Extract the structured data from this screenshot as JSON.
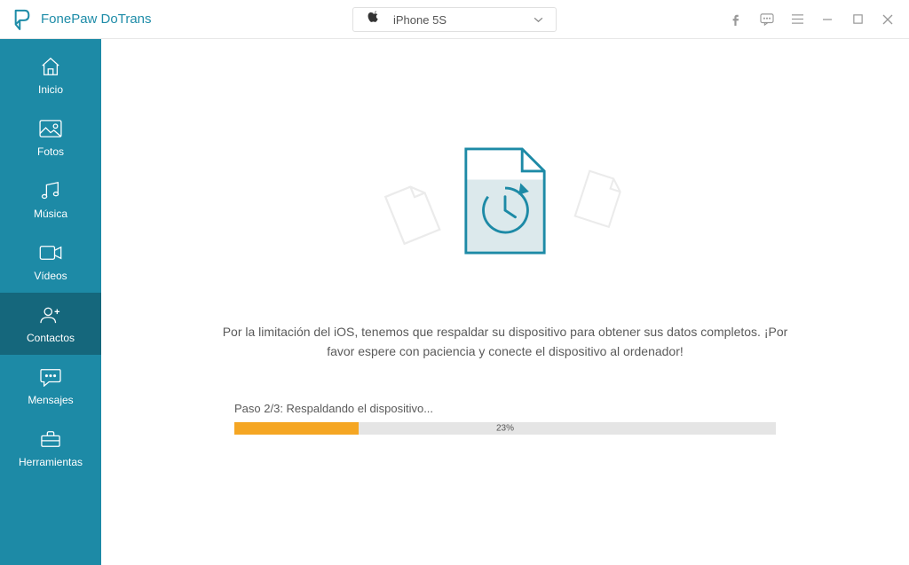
{
  "app": {
    "title": "FonePaw DoTrans"
  },
  "device": {
    "name": "iPhone 5S"
  },
  "sidebar": {
    "items": [
      {
        "label": "Inicio"
      },
      {
        "label": "Fotos"
      },
      {
        "label": "Música"
      },
      {
        "label": "Vídeos"
      },
      {
        "label": "Contactos"
      },
      {
        "label": "Mensajes"
      },
      {
        "label": "Herramientas"
      }
    ],
    "active_index": 4
  },
  "main": {
    "instruction": "Por la limitación del iOS, tenemos que respaldar su dispositivo para obtener sus datos completos. ¡Por favor espere con paciencia y conecte el dispositivo al ordenador!",
    "step_label": "Paso 2/3: Respaldando el dispositivo...",
    "progress_percent": 23,
    "progress_percent_label": "23%"
  },
  "colors": {
    "brand": "#1d8aa6",
    "accent": "#f5a623"
  }
}
